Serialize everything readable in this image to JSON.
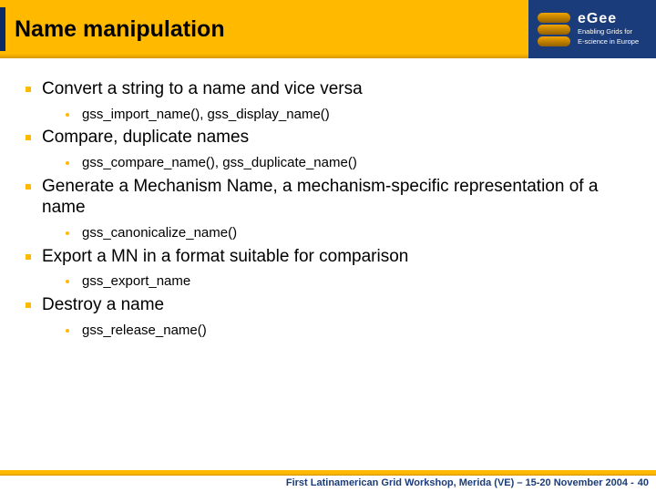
{
  "title": "Name manipulation",
  "logo": {
    "main": "eGee",
    "sub_line1": "Enabling Grids for",
    "sub_line2": "E-science in Europe"
  },
  "bullets": {
    "b0": {
      "text": "Convert a string to a name and vice versa",
      "sub0": "gss_import_name(), gss_display_name()"
    },
    "b1": {
      "text": "Compare, duplicate names",
      "sub0": "gss_compare_name(), gss_duplicate_name()"
    },
    "b2": {
      "text": "Generate a Mechanism Name, a mechanism-specific representation of a name",
      "sub0": "gss_canonicalize_name()"
    },
    "b3": {
      "text": "Export a MN in a format suitable for comparison",
      "sub0": "gss_export_name"
    },
    "b4": {
      "text": "Destroy a name",
      "sub0": "gss_release_name()"
    }
  },
  "footer": {
    "text": "First Latinamerican Grid Workshop, Merida (VE) – 15-20 November 2004 -",
    "page": "40"
  }
}
